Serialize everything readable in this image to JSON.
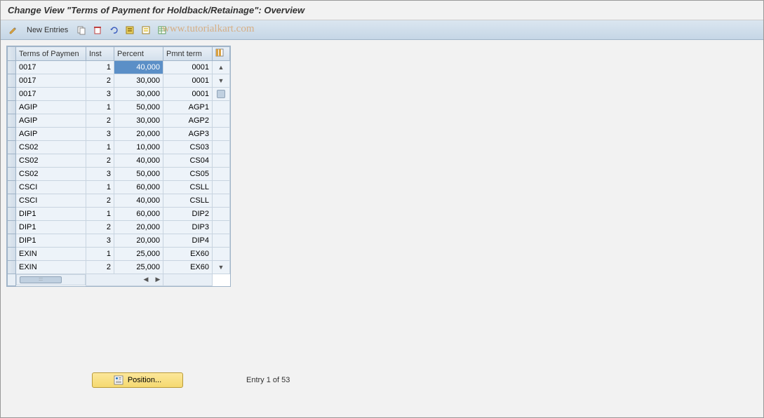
{
  "title": "Change View \"Terms of Payment for Holdback/Retainage\": Overview",
  "toolbar": {
    "new_entries": "New Entries"
  },
  "watermark": "www.tutorialkart.com",
  "table": {
    "headers": {
      "terms": "Terms of Paymen",
      "inst": "Inst",
      "percent": "Percent",
      "pmnt": "Pmnt term"
    },
    "rows": [
      {
        "terms": "0017",
        "inst": "1",
        "percent": "40,000",
        "pmnt": "0001",
        "selected": true
      },
      {
        "terms": "0017",
        "inst": "2",
        "percent": "30,000",
        "pmnt": "0001"
      },
      {
        "terms": "0017",
        "inst": "3",
        "percent": "30,000",
        "pmnt": "0001"
      },
      {
        "terms": "AGIP",
        "inst": "1",
        "percent": "50,000",
        "pmnt": "AGP1"
      },
      {
        "terms": "AGIP",
        "inst": "2",
        "percent": "30,000",
        "pmnt": "AGP2"
      },
      {
        "terms": "AGIP",
        "inst": "3",
        "percent": "20,000",
        "pmnt": "AGP3"
      },
      {
        "terms": "CS02",
        "inst": "1",
        "percent": "10,000",
        "pmnt": "CS03"
      },
      {
        "terms": "CS02",
        "inst": "2",
        "percent": "40,000",
        "pmnt": "CS04"
      },
      {
        "terms": "CS02",
        "inst": "3",
        "percent": "50,000",
        "pmnt": "CS05"
      },
      {
        "terms": "CSCI",
        "inst": "1",
        "percent": "60,000",
        "pmnt": "CSLL"
      },
      {
        "terms": "CSCI",
        "inst": "2",
        "percent": "40,000",
        "pmnt": "CSLL"
      },
      {
        "terms": "DIP1",
        "inst": "1",
        "percent": "60,000",
        "pmnt": "DIP2"
      },
      {
        "terms": "DIP1",
        "inst": "2",
        "percent": "20,000",
        "pmnt": "DIP3"
      },
      {
        "terms": "DIP1",
        "inst": "3",
        "percent": "20,000",
        "pmnt": "DIP4"
      },
      {
        "terms": "EXIN",
        "inst": "1",
        "percent": "25,000",
        "pmnt": "EX60"
      },
      {
        "terms": "EXIN",
        "inst": "2",
        "percent": "25,000",
        "pmnt": "EX60"
      }
    ]
  },
  "footer": {
    "position_label": "Position...",
    "entry_text": "Entry 1 of 53"
  }
}
